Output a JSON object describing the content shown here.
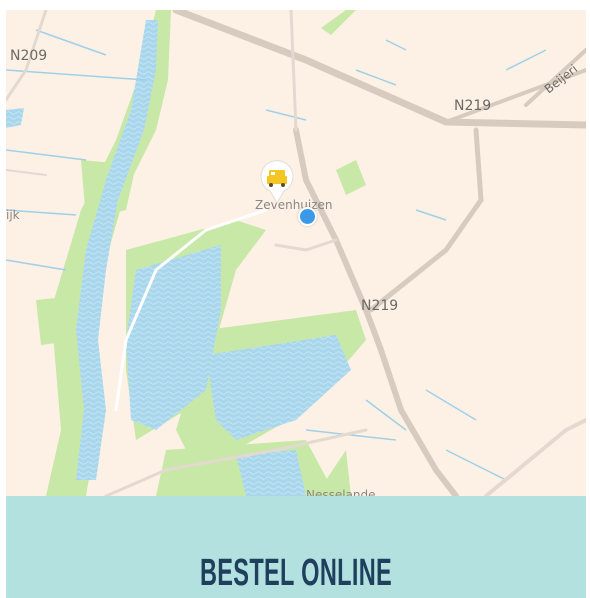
{
  "map": {
    "road_labels": {
      "n209": "N209",
      "n219_top": "N219",
      "n219_mid": "N219",
      "beijer": "Beijeri"
    },
    "place_labels": {
      "zevenhuizen": "Zevenhuizen",
      "ijk": "ijk",
      "nesselande": "Nesselande"
    },
    "colors": {
      "land": "#fdf1e6",
      "park": "#c8e8a8",
      "water": "#9fd0e8",
      "road": "#d7cbbf",
      "user_location": "#3b9ae8"
    },
    "icons": {
      "store_pin": "store-pin-icon",
      "user_location": "user-location-icon"
    }
  },
  "banner": {
    "cta_label": "BESTEL ONLINE",
    "background": "#b2e1e0"
  }
}
